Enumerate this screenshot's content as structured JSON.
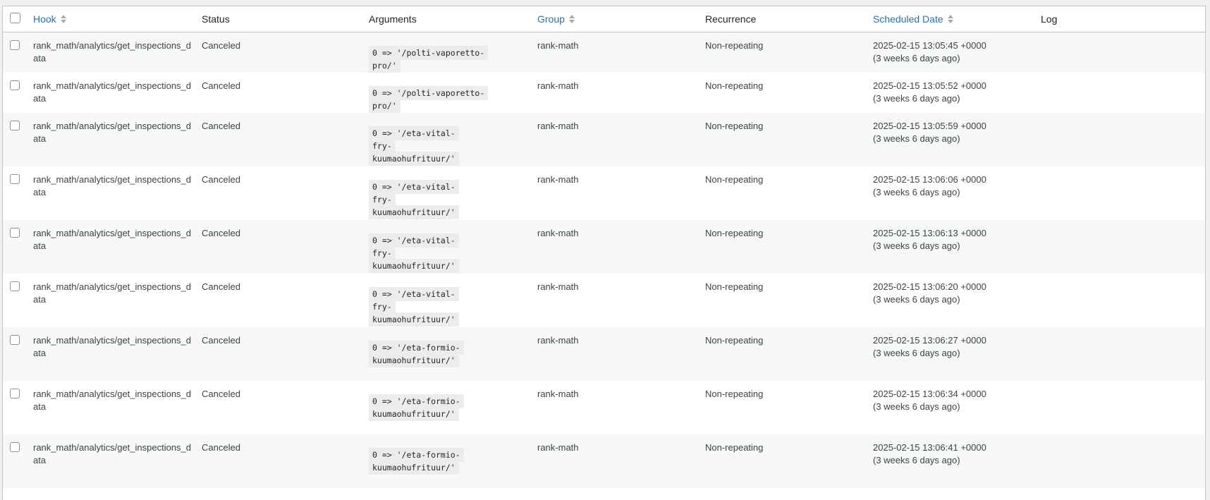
{
  "columns": {
    "hook": "Hook",
    "status": "Status",
    "arguments": "Arguments",
    "group": "Group",
    "recurrence": "Recurrence",
    "scheduled_date": "Scheduled Date",
    "log": "Log"
  },
  "rows": [
    {
      "hook": "rank_math/analytics/get_inspections_data",
      "status": "Canceled",
      "args": "0 => '/polti-vaporetto-pro/'",
      "group": "rank-math",
      "recurrence": "Non-repeating",
      "date": "2025-02-15 13:05:45 +0000",
      "ago": "(3 weeks 6 days ago)"
    },
    {
      "hook": "rank_math/analytics/get_inspections_data",
      "status": "Canceled",
      "args": "0 => '/polti-vaporetto-pro/'",
      "group": "rank-math",
      "recurrence": "Non-repeating",
      "date": "2025-02-15 13:05:52 +0000",
      "ago": "(3 weeks 6 days ago)"
    },
    {
      "hook": "rank_math/analytics/get_inspections_data",
      "status": "Canceled",
      "args": "0 => '/eta-vital-fry-kuumaohufrituur/'",
      "group": "rank-math",
      "recurrence": "Non-repeating",
      "date": "2025-02-15 13:05:59 +0000",
      "ago": "(3 weeks 6 days ago)"
    },
    {
      "hook": "rank_math/analytics/get_inspections_data",
      "status": "Canceled",
      "args": "0 => '/eta-vital-fry-kuumaohufrituur/'",
      "group": "rank-math",
      "recurrence": "Non-repeating",
      "date": "2025-02-15 13:06:06 +0000",
      "ago": "(3 weeks 6 days ago)"
    },
    {
      "hook": "rank_math/analytics/get_inspections_data",
      "status": "Canceled",
      "args": "0 => '/eta-vital-fry-kuumaohufrituur/'",
      "group": "rank-math",
      "recurrence": "Non-repeating",
      "date": "2025-02-15 13:06:13 +0000",
      "ago": "(3 weeks 6 days ago)"
    },
    {
      "hook": "rank_math/analytics/get_inspections_data",
      "status": "Canceled",
      "args": "0 => '/eta-vital-fry-kuumaohufrituur/'",
      "group": "rank-math",
      "recurrence": "Non-repeating",
      "date": "2025-02-15 13:06:20 +0000",
      "ago": "(3 weeks 6 days ago)"
    },
    {
      "hook": "rank_math/analytics/get_inspections_data",
      "status": "Canceled",
      "args": "0 => '/eta-formio-kuumaohufrituur/'",
      "group": "rank-math",
      "recurrence": "Non-repeating",
      "date": "2025-02-15 13:06:27 +0000",
      "ago": "(3 weeks 6 days ago)"
    },
    {
      "hook": "rank_math/analytics/get_inspections_data",
      "status": "Canceled",
      "args": "0 => '/eta-formio-kuumaohufrituur/'",
      "group": "rank-math",
      "recurrence": "Non-repeating",
      "date": "2025-02-15 13:06:34 +0000",
      "ago": "(3 weeks 6 days ago)"
    },
    {
      "hook": "rank_math/analytics/get_inspections_data",
      "status": "Canceled",
      "args": "0 => '/eta-formio-kuumaohufrituur/'",
      "group": "rank-math",
      "recurrence": "Non-repeating",
      "date": "2025-02-15 13:06:41 +0000",
      "ago": "(3 weeks 6 days ago)"
    }
  ]
}
